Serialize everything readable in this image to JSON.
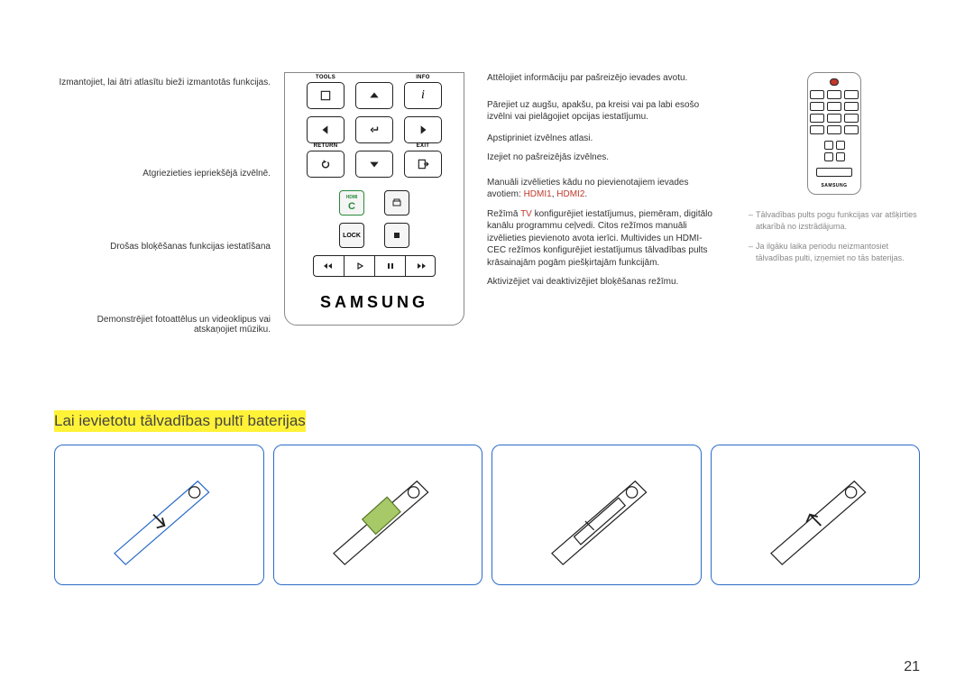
{
  "left": {
    "l1": "Izmantojiet, lai ātri atlasītu bieži izmantotās funkcijas.",
    "l2": "Atgriezieties iepriekšējā izvēlnē.",
    "l3": "Drošas bloķēšanas funkcijas iestatīšana",
    "l4": "Demonstrējiet fotoattēlus un videoklipus vai atskaņojiet mūziku."
  },
  "right": {
    "r1": "Attēlojiet informāciju par pašreizējo ievades avotu.",
    "r2": "Pārejiet uz augšu, apakšu, pa kreisi vai pa labi esošo izvēlni vai pielāgojiet opcijas iestatījumu.",
    "r3": "Apstipriniet izvēlnes atlasi.",
    "r4": "Izejiet no pašreizējās izvēlnes.",
    "r5a": "Manuāli izvēlieties kādu no pievienotajiem ievades avotiem: ",
    "r5b": "HDMI1",
    "r5c": ", ",
    "r5d": "HDMI2",
    "r5e": ".",
    "r6a": "Režīmā ",
    "r6b": "TV",
    "r6c": " konfigurējiet iestatījumus, piemēram, digitālo kanālu programmu ceļvedi. Citos režīmos manuāli izvēlieties pievienoto avota ierīci. Multivides un HDMI-CEC režīmos konfigurējiet iestatījumus tālvadības pults krāsainajām pogām piešķirtajām funkcijām.",
    "r7": "Aktivizējiet vai deaktivizējiet bloķēšanas režīmu."
  },
  "buttons": {
    "tools": "TOOLS",
    "info": "INFO",
    "return": "RETURN",
    "exit": "EXIT",
    "hdmi": "HDMI",
    "c": "C",
    "lock": "LOCK"
  },
  "brand": "SAMSUNG",
  "notes": {
    "n1": "Tālvadības pults pogu funkcijas var atšķirties atkarībā no izstrādājuma.",
    "n2": "Ja ilgāku laika periodu neizmantosiet tālvadības pulti, izņemiet no tās baterijas."
  },
  "section_title": "Lai ievietotu tālvadības pultī baterijas",
  "page": "21"
}
